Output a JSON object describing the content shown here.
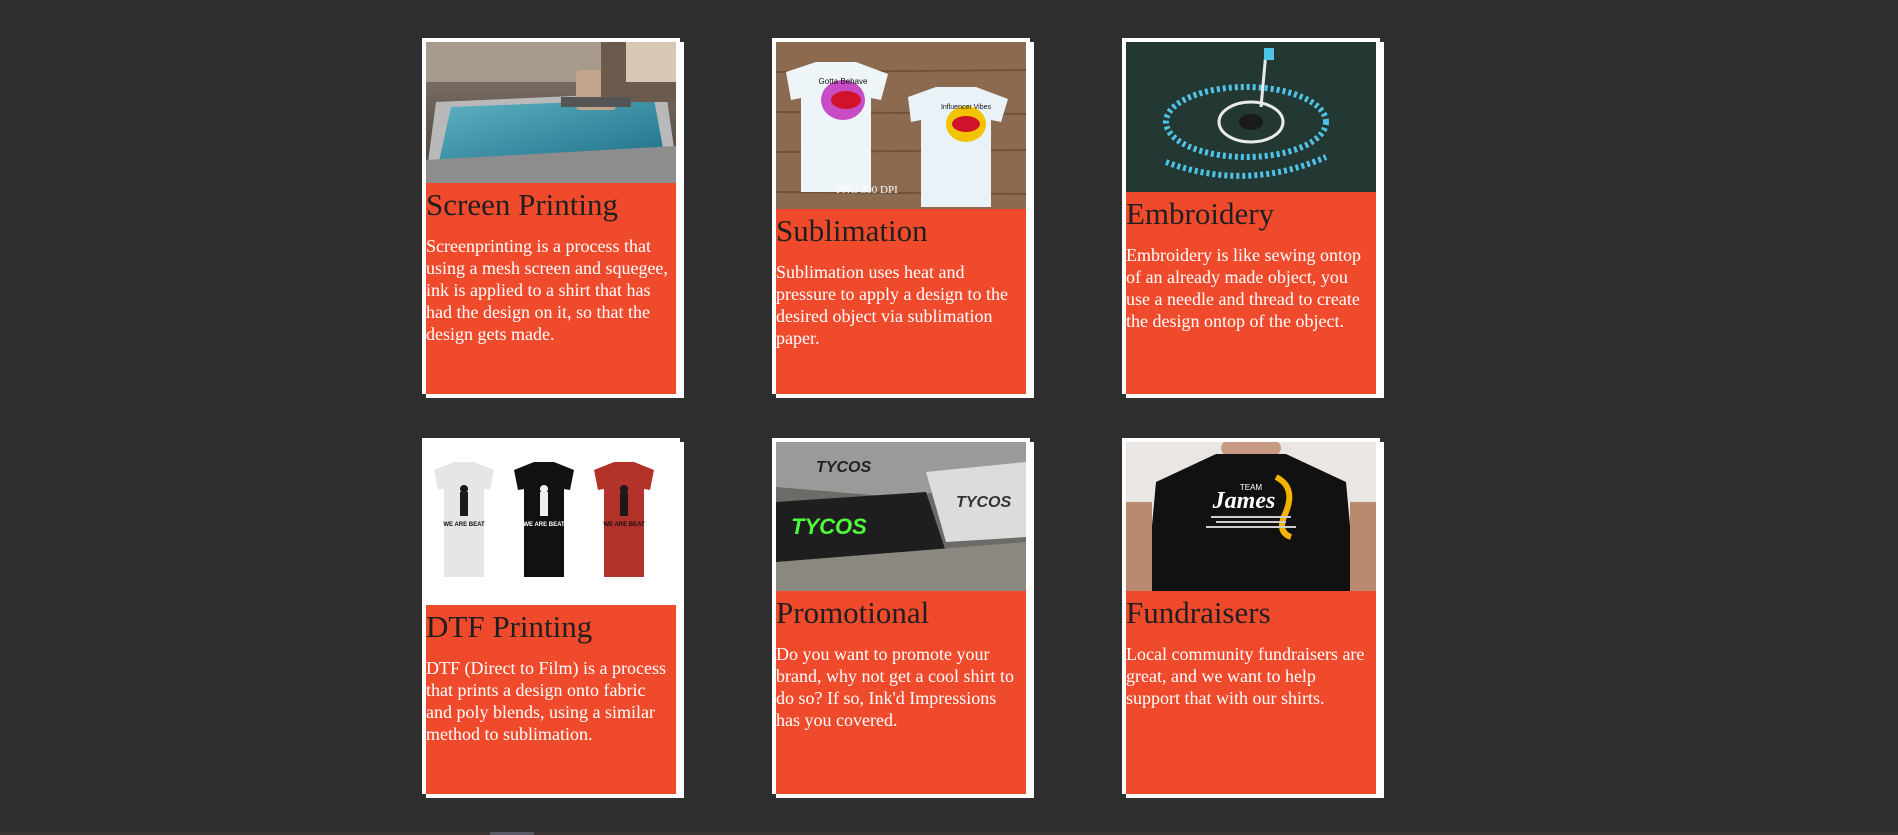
{
  "cards": [
    {
      "title": "Screen Printing",
      "description": "Screenprinting is a process that using a mesh screen and squegee, ink is applied to a shirt that has had the design on it, so that the design gets made."
    },
    {
      "title": "Sublimation",
      "description": "Sublimation uses heat and pressure to apply a design to the desired object via sublimation paper.",
      "image_caption": "PNG 300 DPI",
      "image_shirt_left_text": "Gotta Behave",
      "image_shirt_right_text": "Influencer Vibes"
    },
    {
      "title": "Embroidery",
      "description": "Embroidery is like sewing ontop of an already made object, you use a needle and thread to create the design ontop of the object."
    },
    {
      "title": "DTF Printing",
      "description": "DTF (Direct to Film) is a process that prints a design onto fabric and poly blends, using a similar method to sublimation.",
      "image_shirt_text": "WE ARE BEAT"
    },
    {
      "title": "Promotional",
      "description": "Do you want to promote your brand, why not get a cool shirt to do so? If so, Ink'd Impressions has you covered.",
      "image_brand_text": "TYCOS"
    },
    {
      "title": "Fundraisers",
      "description": "Local community fundraisers are great, and we want to help support that with our shirts.",
      "image_shirt_small_text": "TEAM",
      "image_shirt_big_text": "James"
    }
  ],
  "colors": {
    "page_background": "#2f2f2f",
    "card_accent": "#f04a2d",
    "card_border": "#ffffff",
    "title_text": "#1f1f1f",
    "body_text": "#ffffff"
  }
}
